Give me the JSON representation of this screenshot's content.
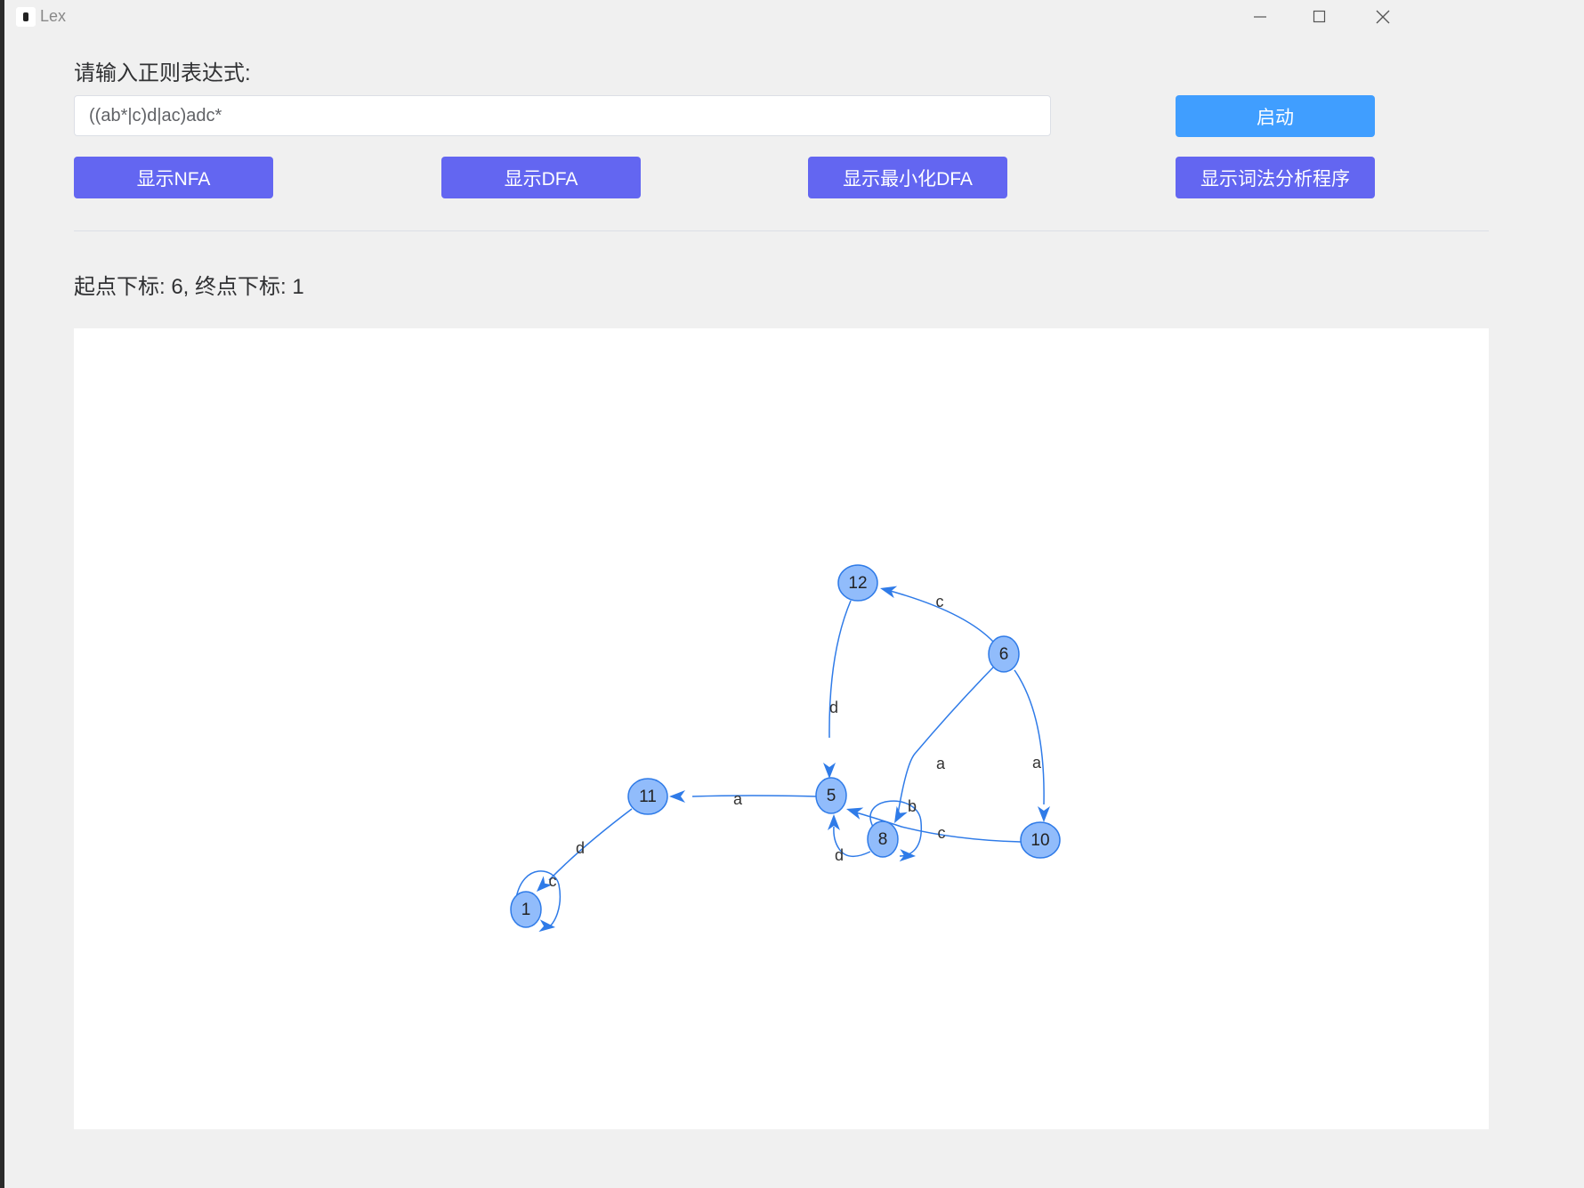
{
  "window": {
    "title": "Lex"
  },
  "form": {
    "prompt_label": "请输入正则表达式:",
    "regex_value": "((ab*|c)d|ac)adc*",
    "start_button": "启动"
  },
  "actions": {
    "show_nfa": "显示NFA",
    "show_dfa": "显示DFA",
    "show_min_dfa": "显示最小化DFA",
    "show_lexer": "显示词法分析程序"
  },
  "status": {
    "text": "起点下标: 6, 终点下标: 1"
  },
  "graph": {
    "nodes": [
      {
        "id": "12",
        "label": "12"
      },
      {
        "id": "6",
        "label": "6"
      },
      {
        "id": "5",
        "label": "5"
      },
      {
        "id": "11",
        "label": "11"
      },
      {
        "id": "8",
        "label": "8"
      },
      {
        "id": "10",
        "label": "10"
      },
      {
        "id": "1",
        "label": "1"
      }
    ],
    "edges": [
      {
        "from": "6",
        "to": "12",
        "label": "c"
      },
      {
        "from": "12",
        "to": "5",
        "label": "d"
      },
      {
        "from": "6",
        "to": "8",
        "label": "a"
      },
      {
        "from": "6",
        "to": "10",
        "label": "a"
      },
      {
        "from": "5",
        "to": "11",
        "label": "a"
      },
      {
        "from": "8",
        "to": "8",
        "label": "b"
      },
      {
        "from": "10",
        "to": "5",
        "label": "c"
      },
      {
        "from": "8",
        "to": "5",
        "label": "d"
      },
      {
        "from": "11",
        "to": "1",
        "label": "d"
      },
      {
        "from": "1",
        "to": "1",
        "label": "c"
      }
    ],
    "colors": {
      "node_fill": "#91bcfb",
      "node_stroke": "#2f7be8",
      "edge": "#2f7be8"
    }
  }
}
